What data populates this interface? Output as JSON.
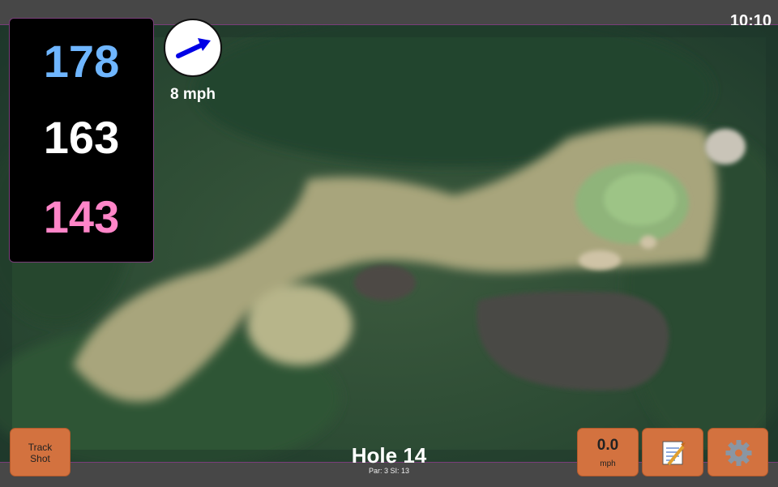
{
  "status": {
    "time": "10:10"
  },
  "yardages": {
    "back": "178",
    "middle": "163",
    "front": "143",
    "back_color": "#6fb6ff",
    "front_color": "#ff85c8"
  },
  "wind": {
    "speed": "8 mph",
    "icon": "wind-arrow-icon",
    "arrow_color": "#0000e6"
  },
  "hole": {
    "title": "Hole 14",
    "meta": "Par: 3   SI: 13"
  },
  "buttons": {
    "track_shot": [
      "Track",
      "Shot"
    ],
    "speed_value": "0.0",
    "speed_unit": "mph",
    "notes_icon": "notepad-icon",
    "settings_icon": "gear-icon"
  },
  "colors": {
    "button": "#d3723f",
    "accent_border": "#7a3d7a"
  }
}
